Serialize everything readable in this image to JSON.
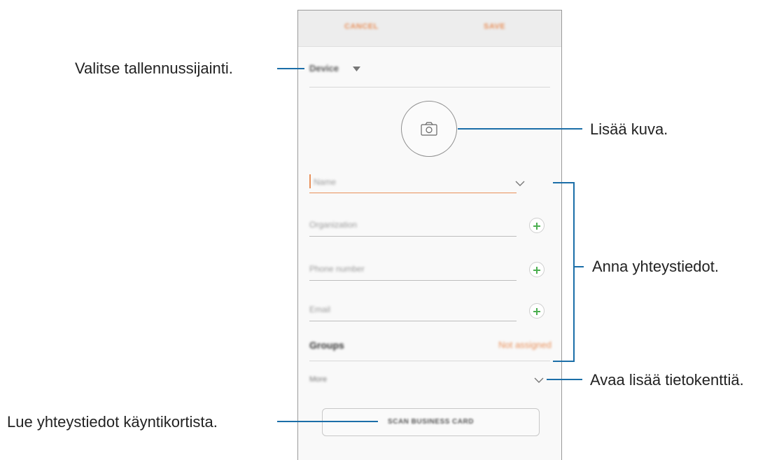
{
  "app_bar": {
    "cancel_label": "CANCEL",
    "save_label": "SAVE"
  },
  "storage": {
    "selected_location": "Device"
  },
  "fields": {
    "name_placeholder": "Name",
    "organization_placeholder": "Organization",
    "phone_placeholder": "Phone number",
    "email_placeholder": "Email"
  },
  "groups": {
    "label": "Groups",
    "value": "Not assigned"
  },
  "more": {
    "label": "More"
  },
  "scan_button": {
    "label": "SCAN BUSINESS CARD"
  },
  "callouts": {
    "storage": "Valitse tallennussijainti.",
    "photo": "Lisää kuva.",
    "details": "Anna yhteystiedot.",
    "more_fields": "Avaa lisää tietokenttiä.",
    "business_card": "Lue yhteystiedot käyntikortista."
  },
  "colors": {
    "accent": "#e8905a",
    "callout_line": "#1b6ea8",
    "plus_icon": "#4caf50"
  },
  "icons": {
    "photo": "camera-icon",
    "expand": "chevron-down-icon",
    "dropdown": "triangle-down-icon",
    "add": "plus-icon"
  }
}
